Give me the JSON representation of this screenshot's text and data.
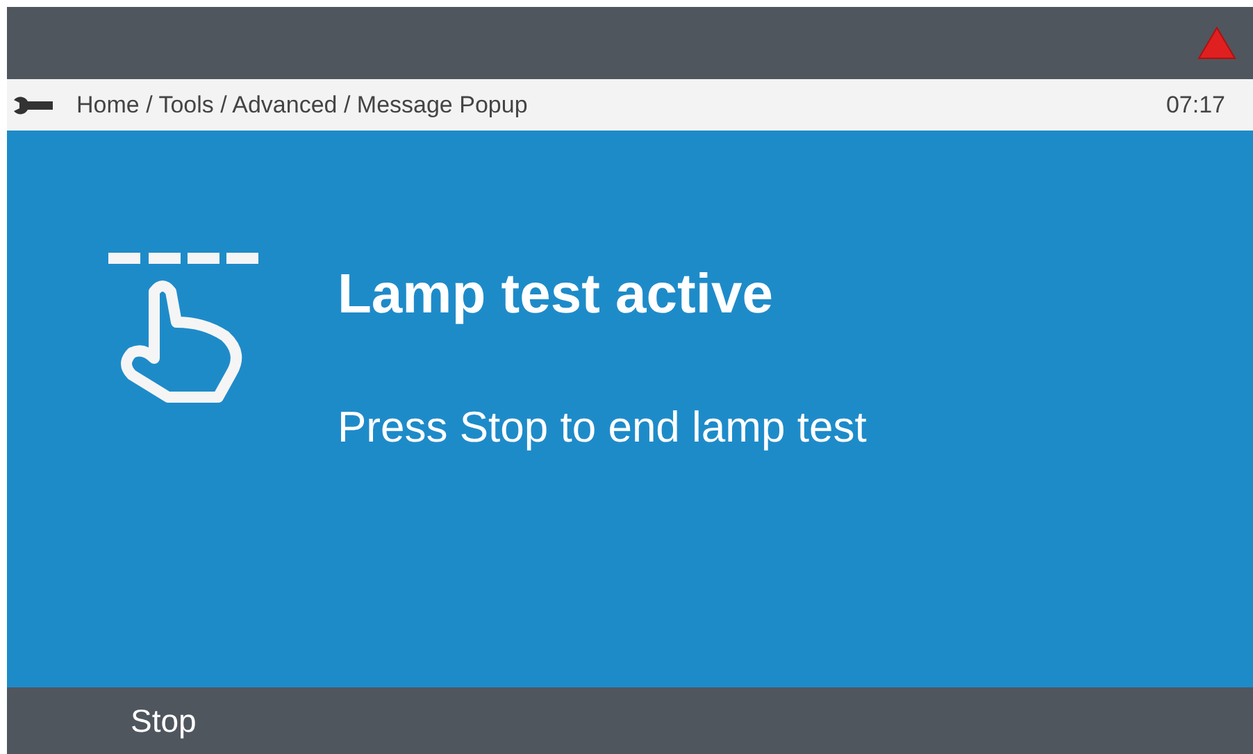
{
  "breadcrumb": {
    "path": "Home / Tools / Advanced / Message Popup",
    "time": "07:17"
  },
  "message": {
    "title": "Lamp test active",
    "text": "Press Stop to end lamp test"
  },
  "softkeys": [
    "Stop"
  ]
}
